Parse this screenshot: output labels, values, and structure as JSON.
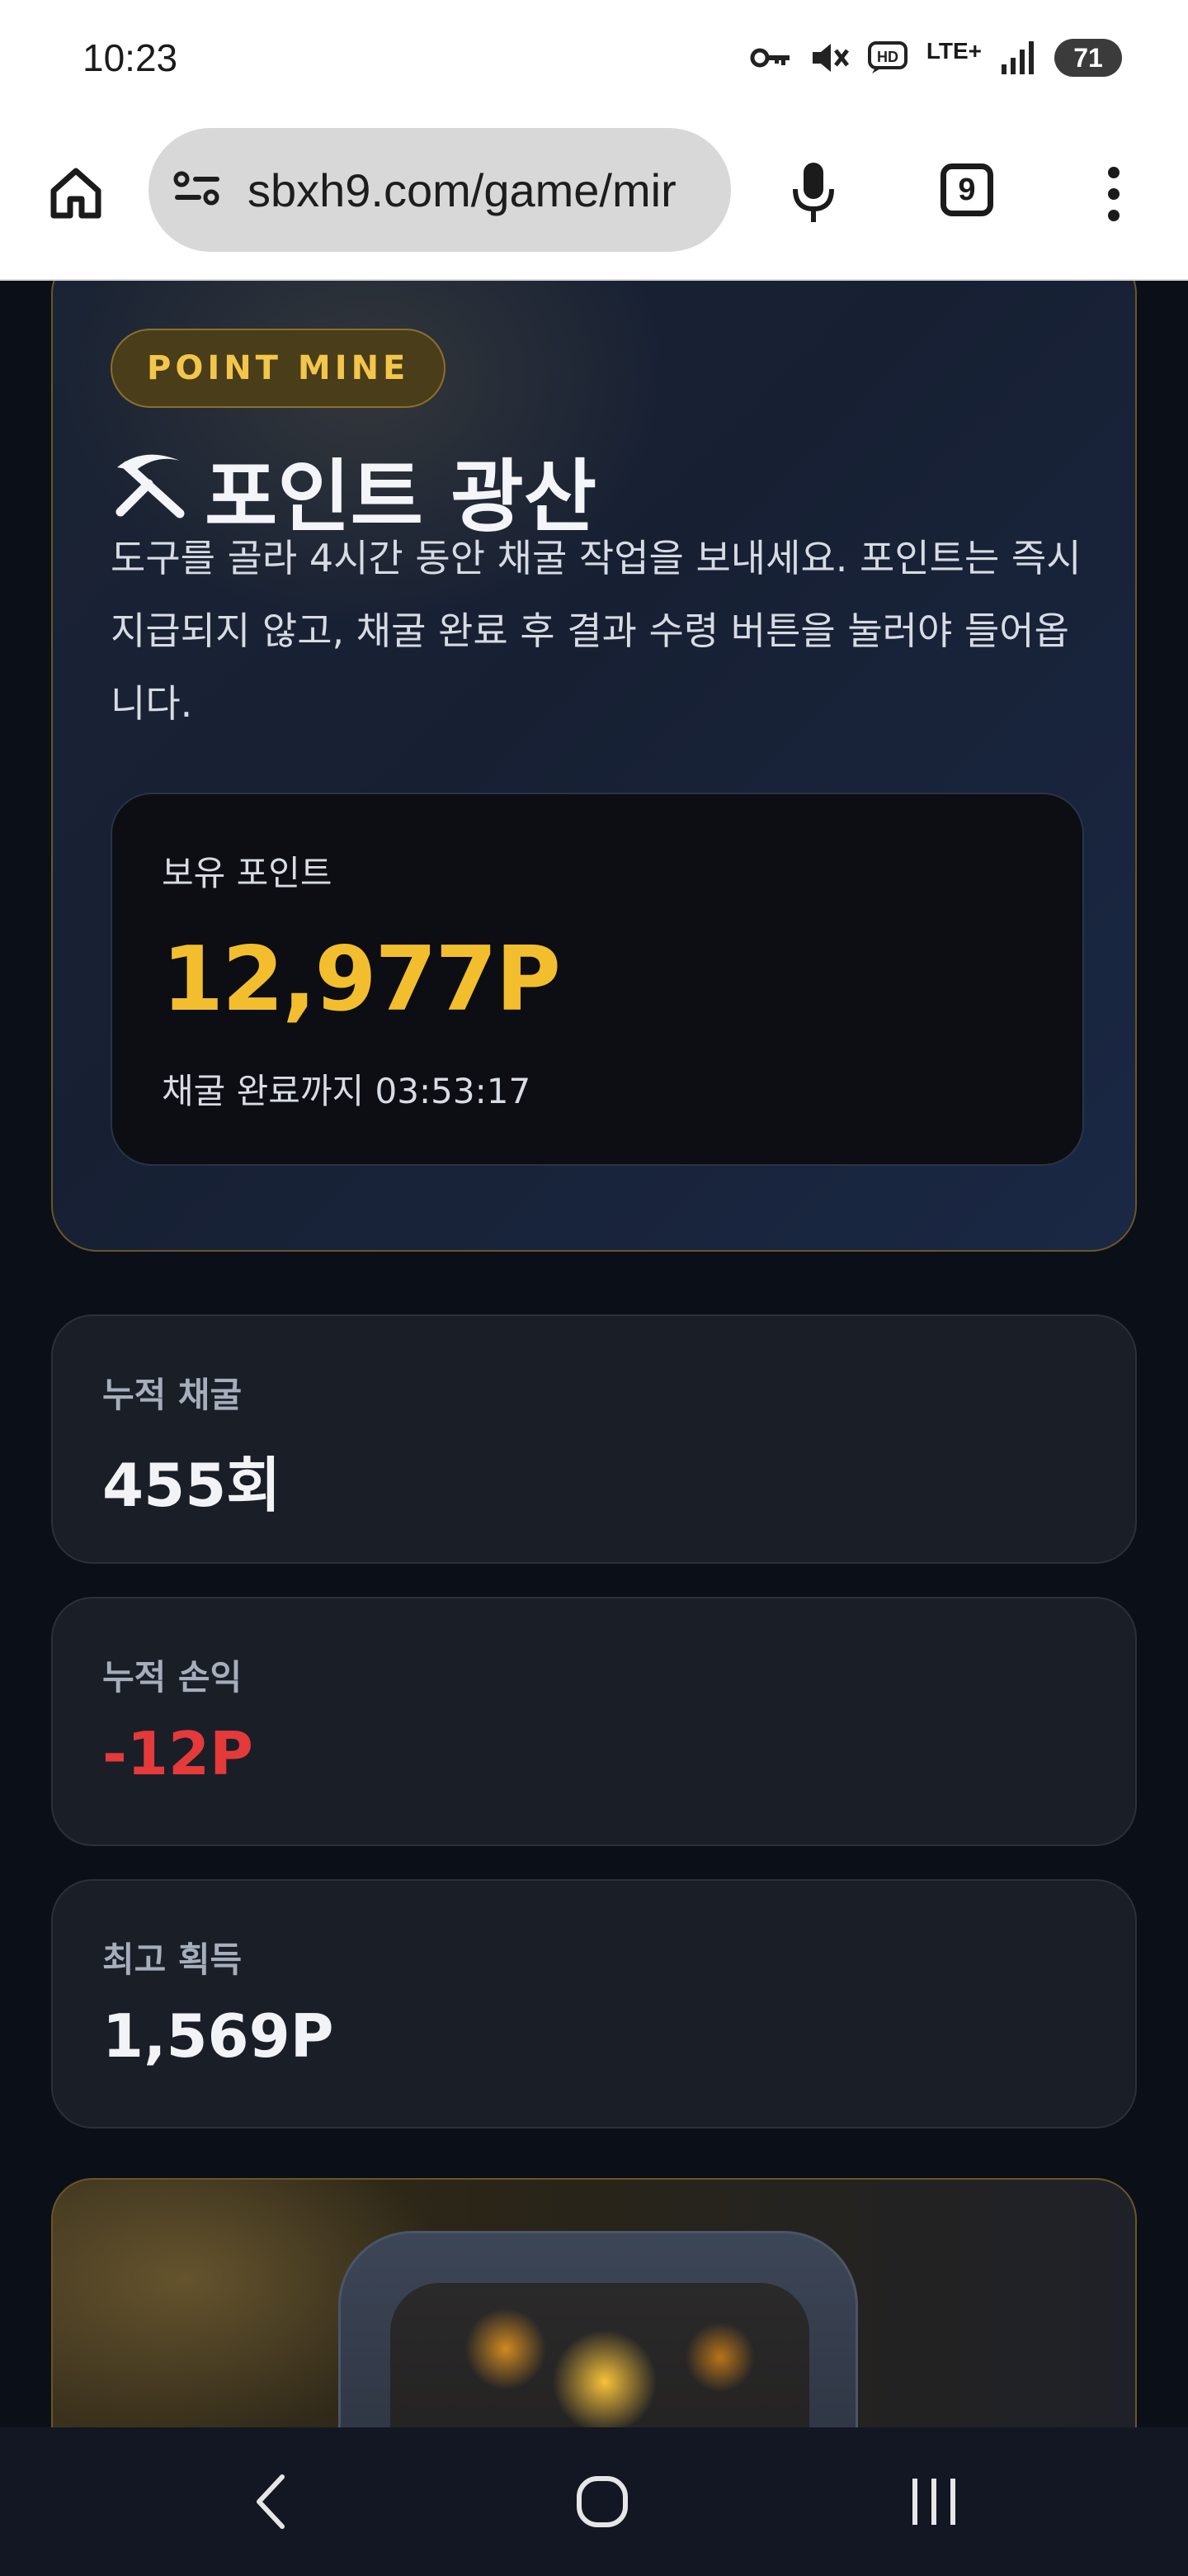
{
  "status_bar": {
    "time": "10:23",
    "network": "LTE+",
    "battery": "71",
    "icons": [
      "vpn-key-icon",
      "mute-icon",
      "hd-icon",
      "lte-icon",
      "signal-icon",
      "battery-icon"
    ]
  },
  "browser": {
    "url": "sbxh9.com/game/mir",
    "tab_count": "9",
    "icons": [
      "home-icon",
      "site-settings-icon",
      "mic-icon",
      "tabs-icon",
      "more-vert-icon"
    ]
  },
  "hero": {
    "badge": "POINT MINE",
    "title": "포인트 광산",
    "description": "도구를 골라 4시간 동안 채굴 작업을 보내세요. 포인트는 즉시 지급되지 않고, 채굴 완료 후 결과 수령 버튼을 눌러야 들어옵니다.",
    "balance_label": "보유 포인트",
    "balance_value": "12,977P",
    "timer_text": "채굴 완료까지 03:53:17"
  },
  "stats": [
    {
      "label": "누적 채굴",
      "value": "455회"
    },
    {
      "label": "누적 손익",
      "value": "-12P"
    },
    {
      "label": "최고 획득",
      "value": "1,569P"
    }
  ],
  "colors": {
    "accent_gold": "#f3be2e",
    "negative": "#e43a3a",
    "background": "#0b0f17"
  },
  "nav": {
    "icons": [
      "back-icon",
      "home-circle-icon",
      "recents-icon"
    ]
  }
}
